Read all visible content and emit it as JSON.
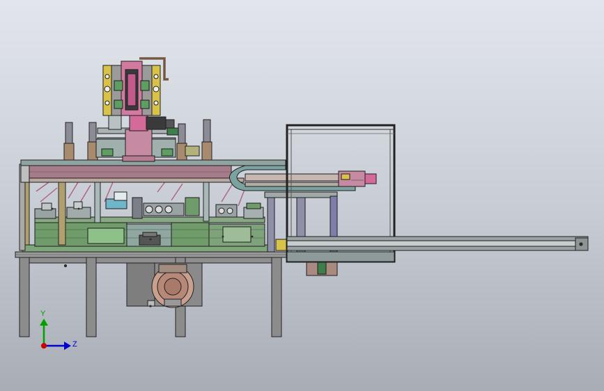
{
  "triad": {
    "y_label": "Y",
    "z_label": "Z",
    "x_color": "#d00000",
    "y_color": "#00a000",
    "z_color": "#0000d0"
  },
  "colors": {
    "background_top": "#e2e6ec",
    "background_bottom": "#a8adb5",
    "frame_gray": "#8c8c8c",
    "base_green": "#6f9c6a",
    "plate_mauve": "#a67c8a",
    "rail_steel": "#9aa3a3",
    "teal": "#7aa3a0",
    "pink": "#d46a9a",
    "cyan": "#6fb6c8",
    "yellow": "#d8c24a",
    "olive": "#9b9b6a",
    "dark_line": "#1e1e1e"
  },
  "icons": [
    "coordinate-triad-icon"
  ]
}
